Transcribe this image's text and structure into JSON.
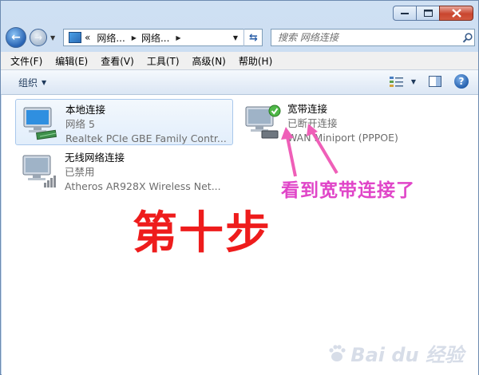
{
  "window": {
    "buttons": {
      "minimize": "minimize",
      "maximize": "maximize",
      "close": "close"
    }
  },
  "address_bar": {
    "prefix": "«",
    "segments": [
      "网络...",
      "网络..."
    ],
    "separator_icon": "chevron-right-icon"
  },
  "search": {
    "placeholder": "搜索 网络连接"
  },
  "menu": {
    "items": [
      "文件(F)",
      "编辑(E)",
      "查看(V)",
      "工具(T)",
      "高级(N)",
      "帮助(H)"
    ]
  },
  "toolbar": {
    "organize_label": "组织"
  },
  "connections": [
    {
      "name": "本地连接",
      "status": "网络  5",
      "device": "Realtek PCIe GBE Family Contr...",
      "icon": "network-adapter-icon"
    },
    {
      "name": "宽带连接",
      "status": "已断开连接",
      "device": "WAN Miniport (PPPOE)",
      "icon": "broadband-connection-icon"
    },
    {
      "name": "无线网络连接",
      "status": "已禁用",
      "device": "Atheros AR928X Wireless Net...",
      "icon": "wireless-adapter-icon"
    }
  ],
  "annotation": {
    "caption": "看到宽带连接了",
    "step": "第十步",
    "color_caption": "#e045c8",
    "color_step": "#ee1c1c"
  },
  "watermark": {
    "text": "Bai du 经验"
  }
}
